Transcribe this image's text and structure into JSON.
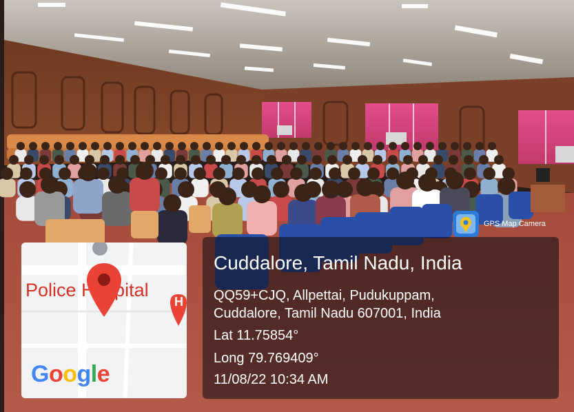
{
  "watermark": {
    "location_title": "Cuddalore, Tamil Nadu, India",
    "address_line_1": "QQ59+CJQ, Allpettai, Pudukuppam,",
    "address_line_2": "Cuddalore, Tamil Nadu 607001, India",
    "latitude": "Lat 11.75854°",
    "longitude": "Long 79.769409°",
    "timestamp": "11/08/22 10:34 AM",
    "app_badge": "GPS Map Camera"
  },
  "map": {
    "place_label": "Police Hospital",
    "logo_text": "Google",
    "marker_icon": "location-pin-icon",
    "side_marker_letter": "H"
  },
  "colors": {
    "panel": "#0a0a0e",
    "map_bg": "#f1f3f4",
    "pin": "#ea4335",
    "google_blue": "#4285f4",
    "google_red": "#ea4335",
    "google_yellow": "#fbbc05",
    "google_green": "#34a853"
  }
}
